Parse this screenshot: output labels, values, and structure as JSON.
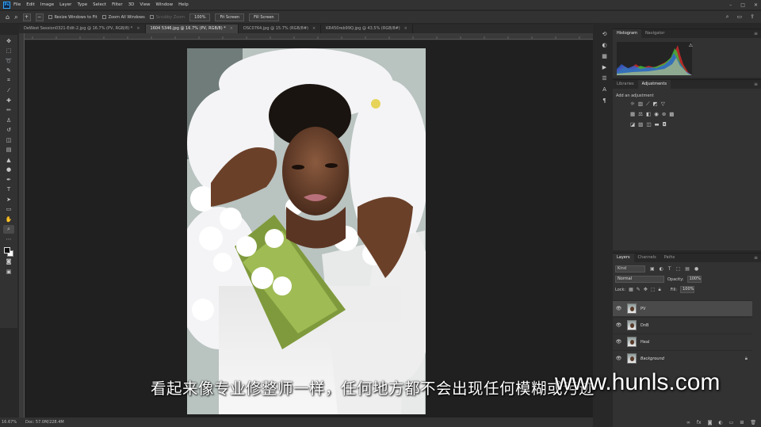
{
  "menubar": {
    "logo": "Ps",
    "items": [
      "File",
      "Edit",
      "Image",
      "Layer",
      "Type",
      "Select",
      "Filter",
      "3D",
      "View",
      "Window",
      "Help"
    ],
    "window_controls": [
      "–",
      "□",
      "✕"
    ]
  },
  "options": {
    "resize_windows": "Resize Windows to Fit",
    "zoom_all": "Zoom All Windows",
    "scrubby_zoom": "Scrubby Zoom",
    "zoom_value": "100%",
    "fit_screen": "Fit Screen",
    "fill_screen": "Fill Screen"
  },
  "tabs": [
    {
      "label": "DeWest Session0321-Edit-2.jpg @ 16.7% (PV, RGB/8) *",
      "active": false
    },
    {
      "label": "1604 5346.jpg @ 16.7% (PV, RGB/8) *",
      "active": true
    },
    {
      "label": "DSC0764.jpg @ 15.7% (RGB/8#)",
      "active": false
    },
    {
      "label": "KR450reb99Q.jpg @ 43.5% (RGB/8#)",
      "active": false
    }
  ],
  "status": {
    "zoom": "16.67%",
    "doc": "Doc: 57.0M/228.4M"
  },
  "histogram_panel": {
    "tabs": [
      "Histogram",
      "Navigator"
    ]
  },
  "adjustments_panel": {
    "tabs": [
      "Libraries",
      "Adjustments"
    ],
    "title": "Add an adjustment"
  },
  "layers_panel": {
    "tabs": [
      "Layers",
      "Channels",
      "Paths"
    ],
    "kind": "Kind",
    "blend": "Normal",
    "opacity_label": "Opacity:",
    "opacity_value": "100%",
    "lock_label": "Lock:",
    "fill_label": "Fill:",
    "fill_value": "100%",
    "layers": [
      {
        "name": "PV",
        "active": true
      },
      {
        "name": "DnB",
        "active": false
      },
      {
        "name": "Heal",
        "active": false
      },
      {
        "name": "Background",
        "active": false
      }
    ]
  },
  "subtitle": "看起来像专业修整师一样，任何地方都不会出现任何模糊或污迹",
  "watermark": "www.hunls.com"
}
